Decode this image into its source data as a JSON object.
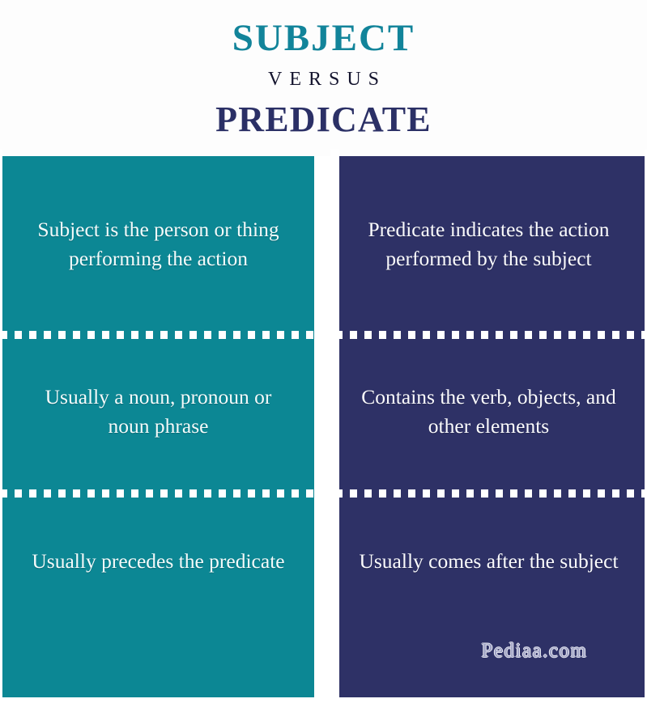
{
  "header": {
    "term_a": "SUBJECT",
    "connector": "VERSUS",
    "term_b": "PREDICATE"
  },
  "colors": {
    "left_panel": "#0c8794",
    "right_panel": "#2e3166",
    "title_a": "#12849a",
    "title_connector": "#14142e",
    "title_b": "#2b3066",
    "text": "#ffffff",
    "background": "#ffffff",
    "divider": "#ffffff"
  },
  "comparison": {
    "left": {
      "heading": "SUBJECT",
      "rows": [
        "Subject is the person or thing performing the action",
        "Usually a noun, pronoun or noun phrase",
        "Usually precedes the predicate"
      ]
    },
    "right": {
      "heading": "PREDICATE",
      "rows": [
        "Predicate indicates the action performed by the subject",
        "Contains the verb, objects, and other elements",
        "Usually comes after the subject"
      ]
    }
  },
  "watermark": {
    "text": "Pediaa.com"
  }
}
